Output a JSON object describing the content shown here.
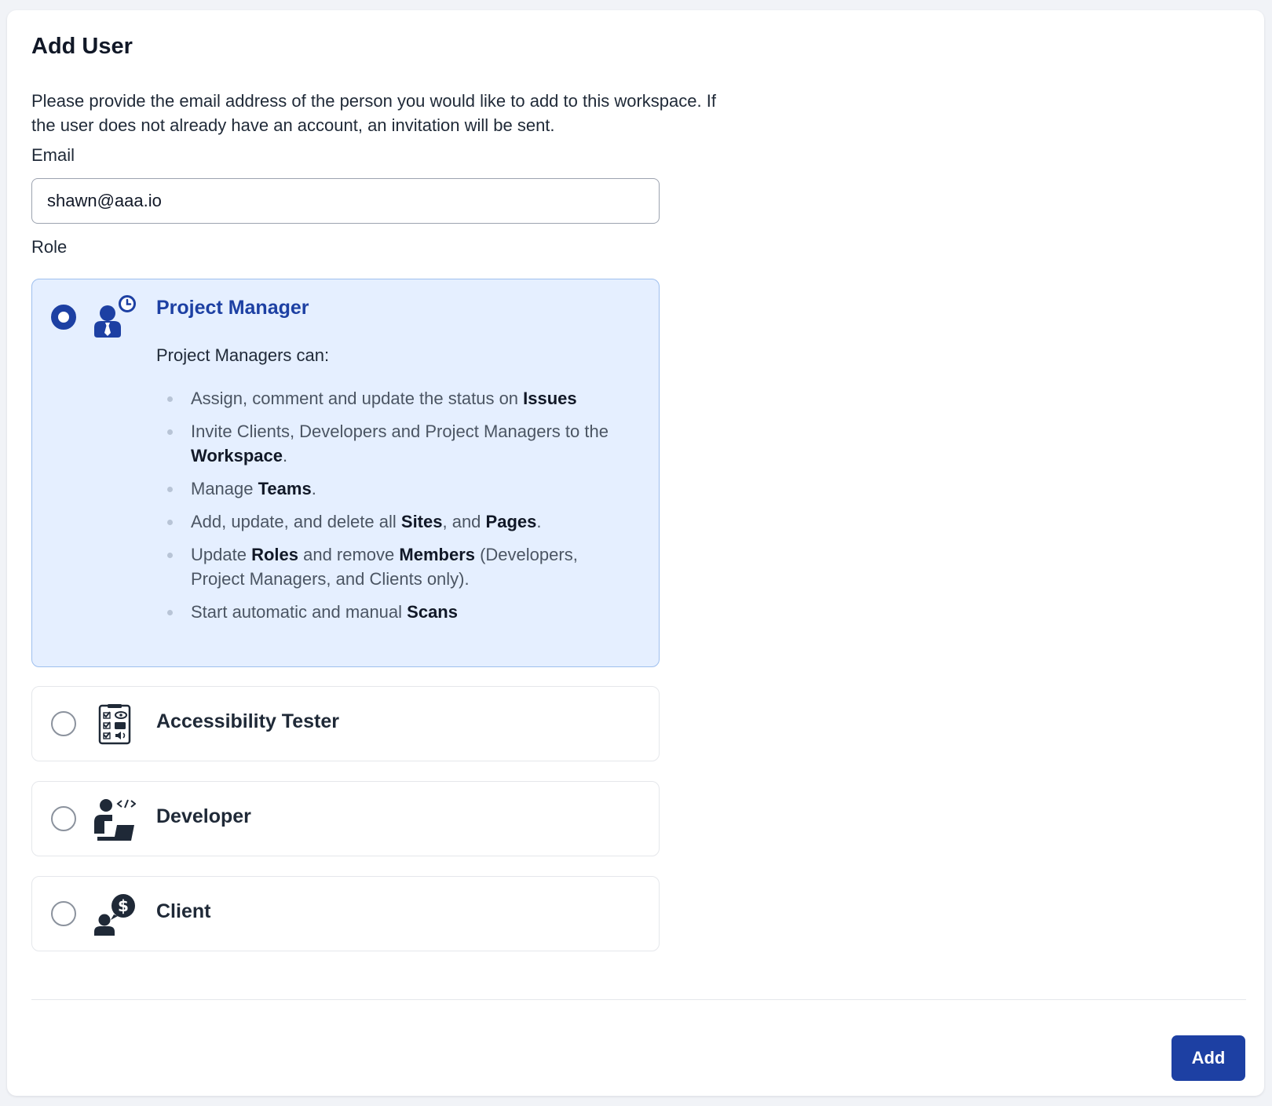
{
  "dialog": {
    "title": "Add User",
    "intro": "Please provide the email address of the person you would like to add to this workspace. If the user does not already have an account, an invitation will be sent."
  },
  "email": {
    "label": "Email",
    "value": "shawn@aaa.io"
  },
  "role": {
    "label": "Role",
    "selected": "Project Manager",
    "options": [
      {
        "title": "Project Manager",
        "icon": "project-manager-icon",
        "checked": true,
        "permissions_intro": "Project Managers can:",
        "permissions": [
          [
            [
              "Assign, comment and update the status on ",
              false
            ],
            [
              "Issues",
              true
            ]
          ],
          [
            [
              "Invite Clients, Developers and Project Managers to the ",
              false
            ],
            [
              "Workspace",
              true
            ],
            [
              ".",
              false
            ]
          ],
          [
            [
              "Manage ",
              false
            ],
            [
              "Teams",
              true
            ],
            [
              ".",
              false
            ]
          ],
          [
            [
              "Add, update, and delete all ",
              false
            ],
            [
              "Sites",
              true
            ],
            [
              ", and ",
              false
            ],
            [
              "Pages",
              true
            ],
            [
              ".",
              false
            ]
          ],
          [
            [
              "Update ",
              false
            ],
            [
              "Roles",
              true
            ],
            [
              " and remove ",
              false
            ],
            [
              "Members",
              true
            ],
            [
              " (Developers, Project Managers, and Clients only).",
              false
            ]
          ],
          [
            [
              "Start automatic and manual ",
              false
            ],
            [
              "Scans",
              true
            ]
          ]
        ]
      },
      {
        "title": "Accessibility Tester",
        "icon": "accessibility-checklist-icon",
        "checked": false
      },
      {
        "title": "Developer",
        "icon": "developer-icon",
        "checked": false
      },
      {
        "title": "Client",
        "icon": "client-icon",
        "checked": false
      }
    ]
  },
  "actions": {
    "add_label": "Add"
  },
  "colors": {
    "primary": "#1d40a3",
    "selected_bg": "#e5efff",
    "selected_border": "#9ebfee",
    "icon_dark": "#1f2937"
  }
}
